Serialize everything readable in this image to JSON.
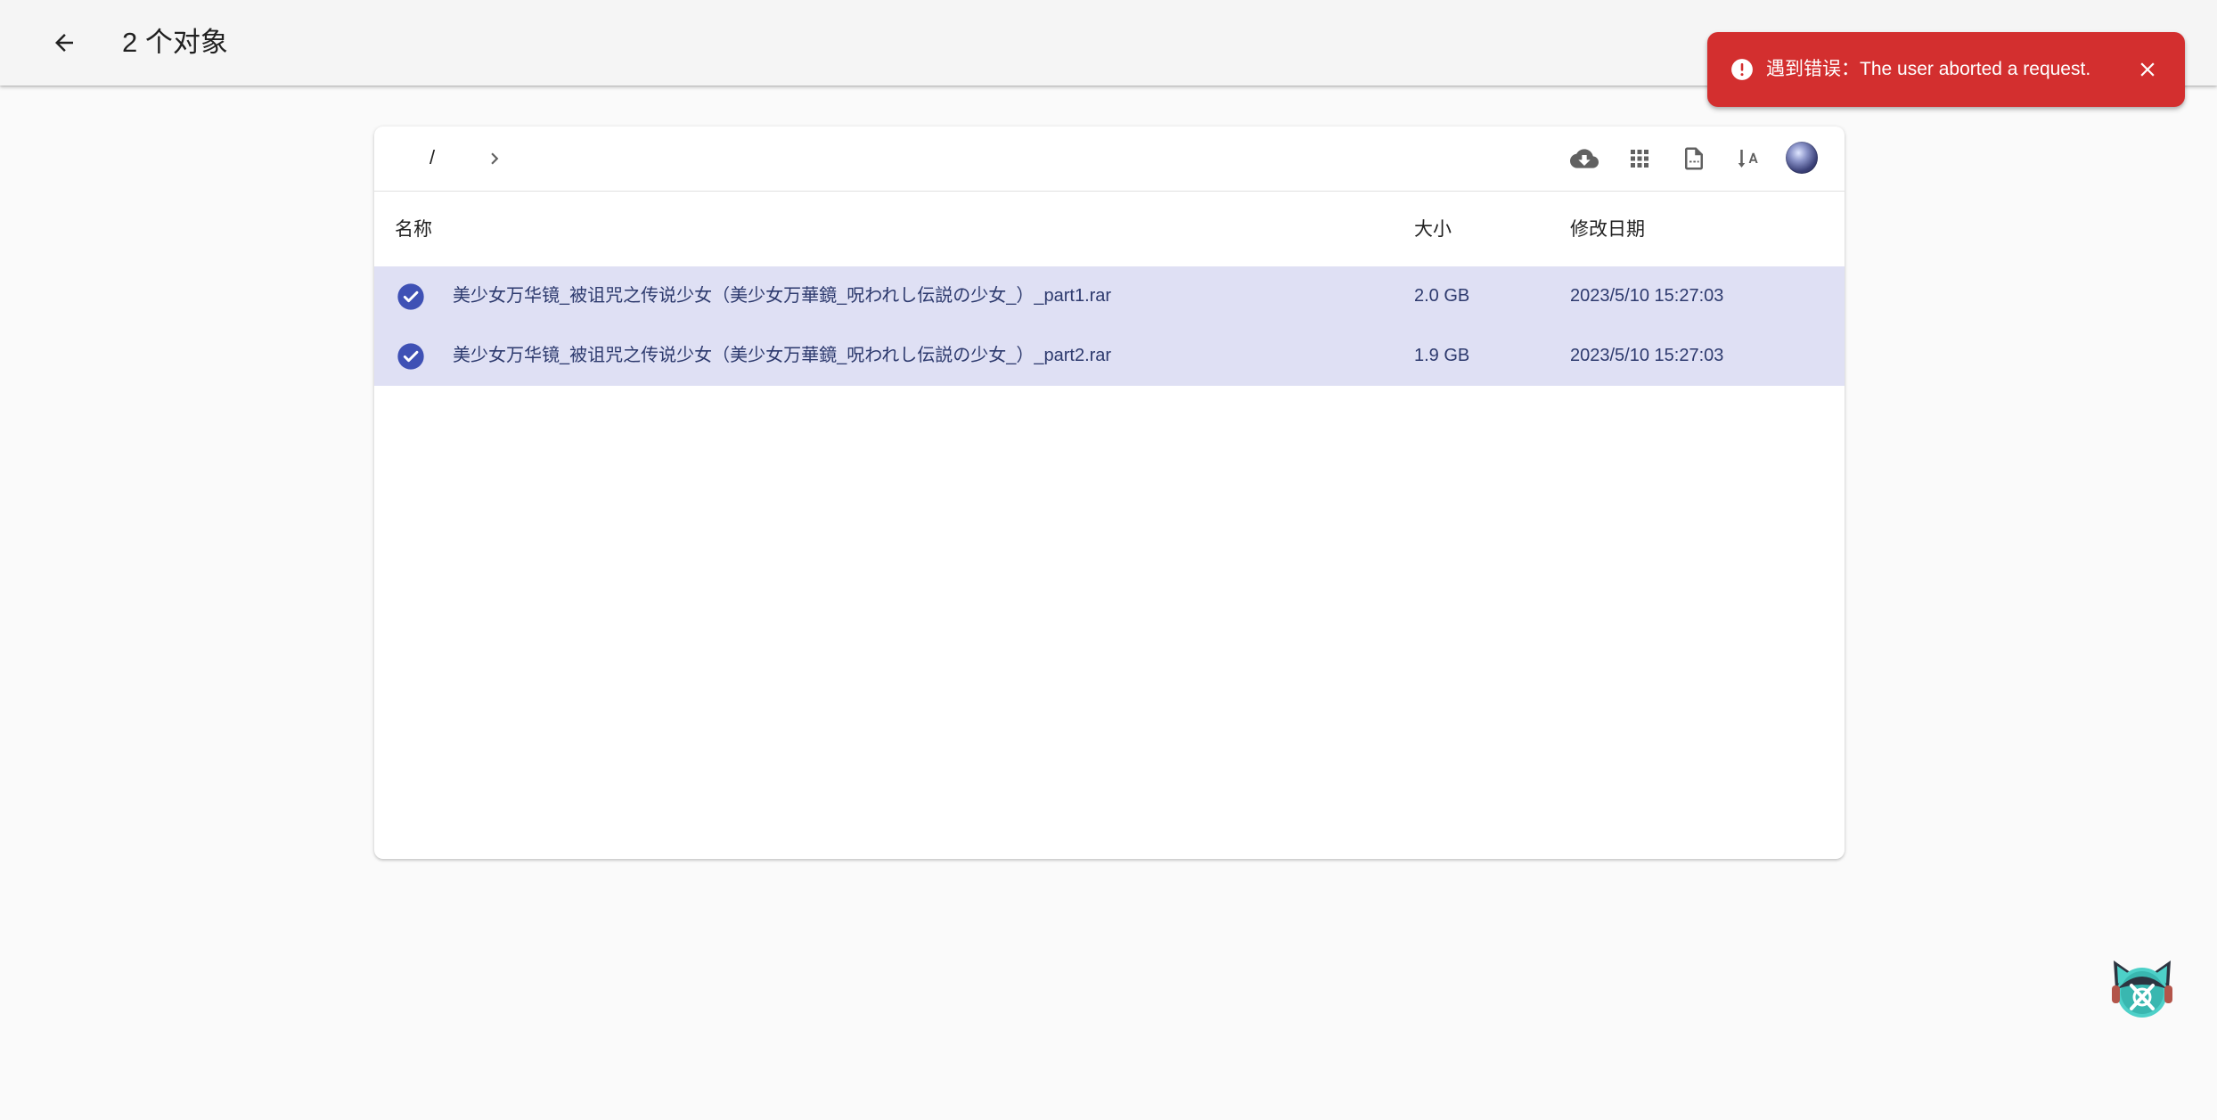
{
  "appbar": {
    "back_icon": "arrow-left-icon",
    "title": "2 个对象"
  },
  "toolbar": {
    "breadcrumb_root": "/",
    "breadcrumb_chevron_icon": "chevron-right-icon",
    "icons": [
      "cloud-download-icon",
      "grid-view-icon",
      "file-dashed-icon",
      "sort-alpha-icon"
    ],
    "avatar": "user-avatar"
  },
  "table": {
    "columns": {
      "name": "名称",
      "size": "大小",
      "modified": "修改日期"
    },
    "rows": [
      {
        "name": "美少女万华镜_被诅咒之传说少女（美少女万華鏡_呪われし伝説の少女_）_part1.rar",
        "size": "2.0 GB",
        "modified": "2023/5/10 15:27:03",
        "selected": true
      },
      {
        "name": "美少女万华镜_被诅咒之传说少女（美少女万華鏡_呪われし伝説の少女_）_part2.rar",
        "size": "1.9 GB",
        "modified": "2023/5/10 15:27:03",
        "selected": true
      }
    ]
  },
  "toast": {
    "message": "遇到错误：The user aborted a request.",
    "icon": "alert-circle-icon",
    "close_icon": "close-icon",
    "color": "#d32f2f"
  },
  "colors": {
    "selected_row": "#dfe0f4",
    "check": "#3f51b5",
    "appbar": "#f5f5f5"
  }
}
